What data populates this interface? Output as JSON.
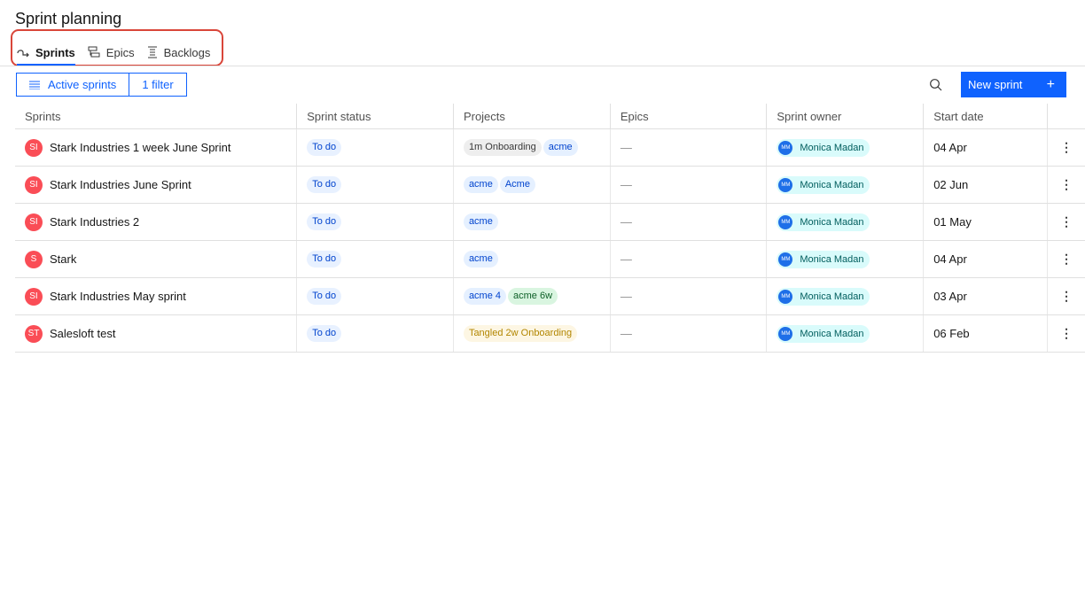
{
  "page": {
    "title": "Sprint planning"
  },
  "tabs": [
    {
      "label": "Sprints",
      "icon": "sprint-icon",
      "active": true
    },
    {
      "label": "Epics",
      "icon": "epics-icon",
      "active": false
    },
    {
      "label": "Backlogs",
      "icon": "backlogs-icon",
      "active": false
    }
  ],
  "toolbar": {
    "view_label": "Active sprints",
    "filter_label": "1 filter",
    "new_sprint_label": "New sprint",
    "new_sprint_icon": "+"
  },
  "table": {
    "columns": [
      "Sprints",
      "Sprint status",
      "Projects",
      "Epics",
      "Sprint owner",
      "Start date"
    ],
    "rows": [
      {
        "initials": "SI",
        "name": "Stark Industries 1 week June Sprint",
        "status": "To do",
        "projects": [
          {
            "label": "1m Onboarding",
            "color": "gray"
          },
          {
            "label": "acme",
            "color": "blue"
          }
        ],
        "epics": "—",
        "owner_initials": "MM",
        "owner": "Monica Madan",
        "start_date": "04 Apr",
        "menu": "⋮"
      },
      {
        "initials": "SI",
        "name": "Stark Industries June Sprint",
        "status": "To do",
        "projects": [
          {
            "label": "acme",
            "color": "blue"
          },
          {
            "label": "Acme",
            "color": "blue"
          }
        ],
        "epics": "—",
        "owner_initials": "MM",
        "owner": "Monica Madan",
        "start_date": "02 Jun",
        "menu": "⋮"
      },
      {
        "initials": "SI",
        "name": "Stark Industries 2",
        "status": "To do",
        "projects": [
          {
            "label": "acme",
            "color": "blue"
          }
        ],
        "epics": "—",
        "owner_initials": "MM",
        "owner": "Monica Madan",
        "start_date": "01 May",
        "menu": "⋮"
      },
      {
        "initials": "S",
        "name": "Stark",
        "status": "To do",
        "projects": [
          {
            "label": "acme",
            "color": "blue"
          }
        ],
        "epics": "—",
        "owner_initials": "MM",
        "owner": "Monica Madan",
        "start_date": "04 Apr",
        "menu": "⋮"
      },
      {
        "initials": "SI",
        "name": "Stark Industries May sprint",
        "status": "To do",
        "projects": [
          {
            "label": "acme 4",
            "color": "blue"
          },
          {
            "label": "acme 6w",
            "color": "green"
          }
        ],
        "epics": "—",
        "owner_initials": "MM",
        "owner": "Monica Madan",
        "start_date": "03 Apr",
        "menu": "⋮"
      },
      {
        "initials": "ST",
        "name": "Salesloft test",
        "status": "To do",
        "projects": [
          {
            "label": "Tangled 2w Onboarding",
            "color": "yellow"
          }
        ],
        "epics": "—",
        "owner_initials": "MM",
        "owner": "Monica Madan",
        "start_date": "06 Feb",
        "menu": "⋮"
      }
    ]
  },
  "colors": {
    "primary": "#0f62fe",
    "avatar": "#fa4d56",
    "owner_avatar": "#1e6fe8",
    "highlight": "#d9463a"
  }
}
